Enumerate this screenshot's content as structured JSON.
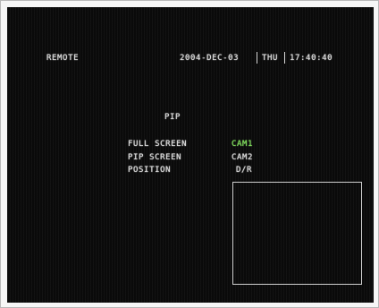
{
  "header": {
    "left_label": "REMOTE",
    "date": "2004-DEC-03",
    "day": "THU",
    "time": "17:40:40"
  },
  "menu": {
    "title": "PIP",
    "rows": [
      {
        "label": "FULL SCREEN",
        "value": "CAM1"
      },
      {
        "label": "PIP SCREEN",
        "value": "CAM2"
      },
      {
        "label": "POSITION",
        "value": "D/R"
      }
    ]
  },
  "colors": {
    "background": "#0a0a0a",
    "text": "#d9d9d9",
    "selected_value": "#7fdc5a"
  }
}
